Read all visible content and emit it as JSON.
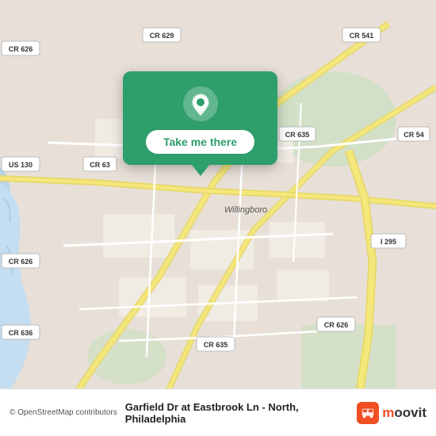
{
  "map": {
    "background_color": "#e8e0d8",
    "center_lat": 40.02,
    "center_lon": -74.97
  },
  "card": {
    "background_color": "#2e9e6b",
    "button_label": "Take me there",
    "pin_icon": "location-pin"
  },
  "bottom_bar": {
    "copyright": "© OpenStreetMap contributors",
    "location_title": "Garfield Dr at Eastbrook Ln - North, Philadelphia",
    "moovit_label": "moovit",
    "moovit_bus_icon": "🚌"
  },
  "road_labels": [
    "CR 626",
    "CR 629",
    "CR 541",
    "US 130",
    "CR 635",
    "CR 54",
    "CR 626",
    "I 295",
    "CR 636",
    "CR 635",
    "CR 626"
  ]
}
